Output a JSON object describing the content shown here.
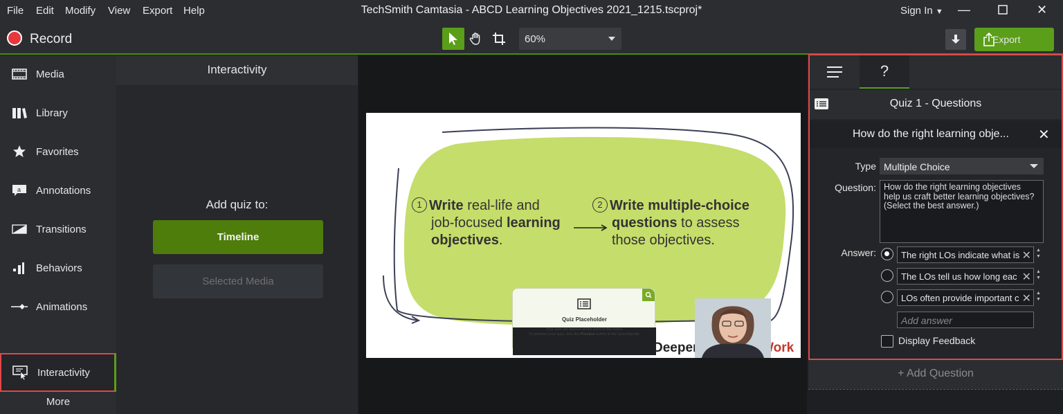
{
  "menubar": {
    "items": [
      "File",
      "Edit",
      "Modify",
      "View",
      "Export",
      "Help"
    ],
    "title": "TechSmith Camtasia - ABCD Learning Objectives 2021_1215.tscproj*",
    "sign_in": "Sign In",
    "window_controls": [
      "minimize-icon",
      "maximize-icon",
      "close-icon"
    ]
  },
  "toolbar": {
    "record_label": "Record",
    "zoom_value": "60%",
    "export_label": "Export",
    "accent": "#5b9e1a",
    "record_color": "#e8383d"
  },
  "sidebar": {
    "items": [
      {
        "label": "Media",
        "icon": "film-icon"
      },
      {
        "label": "Library",
        "icon": "library-icon"
      },
      {
        "label": "Favorites",
        "icon": "star-icon"
      },
      {
        "label": "Annotations",
        "icon": "annotation-icon"
      },
      {
        "label": "Transitions",
        "icon": "transition-icon"
      },
      {
        "label": "Behaviors",
        "icon": "behaviors-icon"
      },
      {
        "label": "Animations",
        "icon": "animation-icon"
      },
      {
        "label": "Interactivity",
        "icon": "interactivity-icon",
        "active": true
      }
    ],
    "more_label": "More"
  },
  "interactivity_panel": {
    "title": "Interactivity",
    "add_quiz_label": "Add quiz to:",
    "timeline_button": "Timeline",
    "selected_media_button": "Selected Media"
  },
  "canvas": {
    "step1": {
      "num": "1",
      "line1a": "Write",
      "line1b": " real-life and",
      "line2a": "job-focused ",
      "line2b": "learning",
      "line3": "objectives",
      "line3b": "."
    },
    "step2": {
      "num": "2",
      "line1a": "Write ",
      "line1b": "multiple-choice",
      "line2a": "questions",
      "line2b": " to assess",
      "line3": "those objectives."
    },
    "quiz_placeholder": {
      "title": "Quiz Placeholder",
      "line1": "Your quiz will appear at this point in the video.",
      "line2a": "To preview your quiz, click the ",
      "line2b": "Preview",
      "line2c": " button in the Quizzing tab."
    },
    "watermark_left": "Deeper",
    "watermark_right": "Work"
  },
  "properties": {
    "tabs": [
      {
        "icon": "list-icon"
      },
      {
        "label": "?"
      }
    ],
    "quiz_title": "Quiz 1 - Questions",
    "question_title": "How do the right learning obje...",
    "type_label": "Type",
    "type_value": "Multiple Choice",
    "question_label": "Question:",
    "question_text": "How do the right learning objectives help us craft better learning objectives? (Select the best answer.)",
    "answer_label": "Answer:",
    "answers": [
      {
        "text": "The right LOs indicate what is",
        "selected": true
      },
      {
        "text": "The LOs tell us how long eac",
        "selected": false
      },
      {
        "text": "LOs often provide important c",
        "selected": false
      }
    ],
    "add_answer_placeholder": "Add answer",
    "display_feedback_label": "Display Feedback",
    "add_question_label": "+ Add Question"
  }
}
